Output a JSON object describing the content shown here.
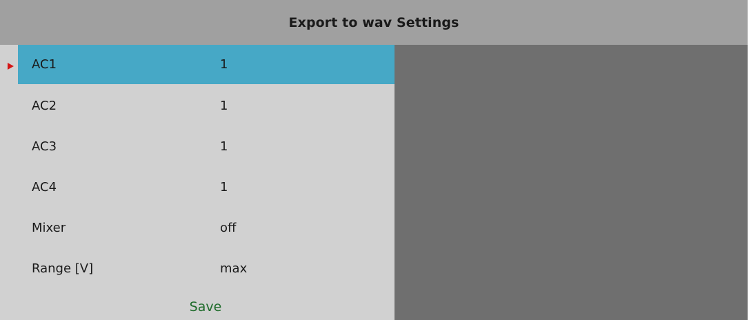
{
  "window": {
    "title": "Export to wav Settings"
  },
  "settings": {
    "selected_index": 0,
    "rows": [
      {
        "label": "AC1",
        "value": "1"
      },
      {
        "label": "AC2",
        "value": "1"
      },
      {
        "label": "AC3",
        "value": "1"
      },
      {
        "label": "AC4",
        "value": "1"
      },
      {
        "label": "Mixer",
        "value": "off"
      },
      {
        "label": "Range [V]",
        "value": "max"
      }
    ],
    "save_label": "Save"
  },
  "icons": {
    "selection_cursor": "triangle-right-icon"
  },
  "colors": {
    "title_bar": "#a0a0a0",
    "panel": "#d1d1d1",
    "selected_row": "#46a8c6",
    "right_area": "#6f6f6f",
    "cursor_arrow": "#d41515",
    "save_text": "#1e6b2a"
  }
}
